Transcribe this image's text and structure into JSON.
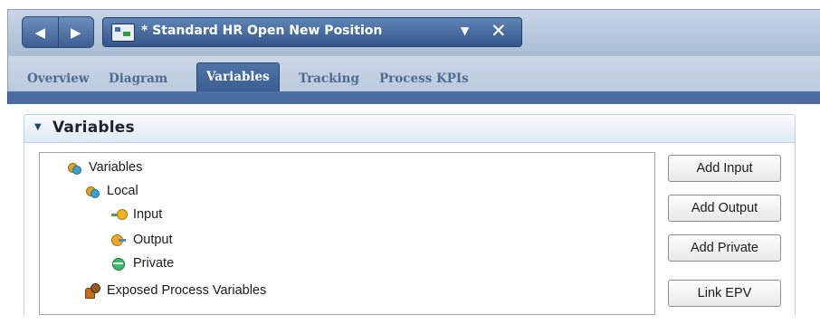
{
  "editor": {
    "document_title": "* Standard HR Open New Position",
    "dropdown_glyph": "▼",
    "close_glyph": "✕",
    "back_glyph": "◀",
    "forward_glyph": "▶",
    "icon": "process-app-icon"
  },
  "tabs": [
    {
      "label": "Overview",
      "active": false
    },
    {
      "label": "Diagram",
      "active": false
    },
    {
      "label": "Variables",
      "active": true
    },
    {
      "label": "Tracking",
      "active": false
    },
    {
      "label": "Process KPIs",
      "active": false
    }
  ],
  "section": {
    "caret": "▼",
    "title": "Variables"
  },
  "tree": [
    {
      "label": "Variables",
      "icon": "variables-icon",
      "level": 0
    },
    {
      "label": "Local",
      "icon": "local-variables-icon",
      "level": 1
    },
    {
      "label": "Input",
      "icon": "input-variable-icon",
      "level": 2
    },
    {
      "label": "Output",
      "icon": "output-variable-icon",
      "level": 2
    },
    {
      "label": "Private",
      "icon": "private-variable-icon",
      "level": 2
    },
    {
      "label": "Exposed Process Variables",
      "icon": "exposed-process-variables-icon",
      "level": 1
    }
  ],
  "buttons": {
    "add_input": "Add Input",
    "add_output": "Add Output",
    "add_private": "Add Private",
    "link_epv": "Link EPV"
  },
  "colors": {
    "active_tab": "#4e74a8",
    "tab_bar": "#cbd7e6",
    "tab_text": "#4e6b92"
  }
}
